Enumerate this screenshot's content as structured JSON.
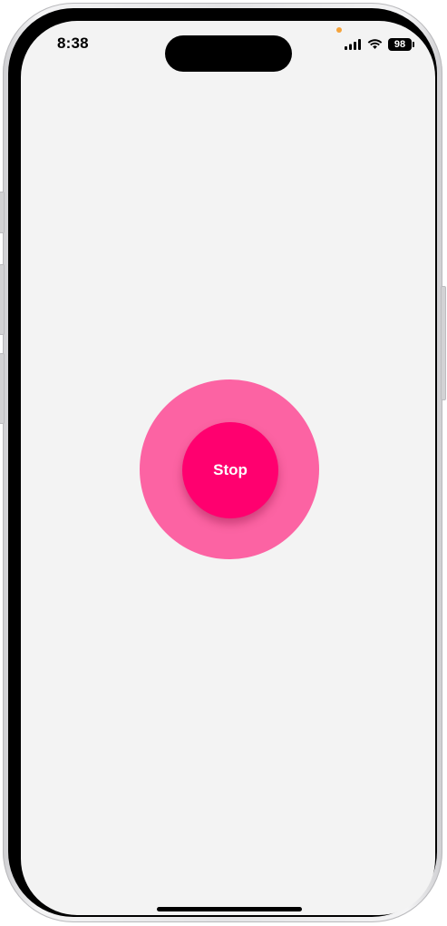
{
  "status_bar": {
    "time": "8:38",
    "battery_level": "98",
    "signal_icon": "cellular-signal-icon",
    "wifi_icon": "wifi-icon",
    "privacy_indicator_color": "#f5a33a"
  },
  "main": {
    "stop_button_label": "Stop",
    "ring_color": "#fc63a3",
    "button_color": "#ff006f",
    "background_color": "#f3f3f3"
  }
}
